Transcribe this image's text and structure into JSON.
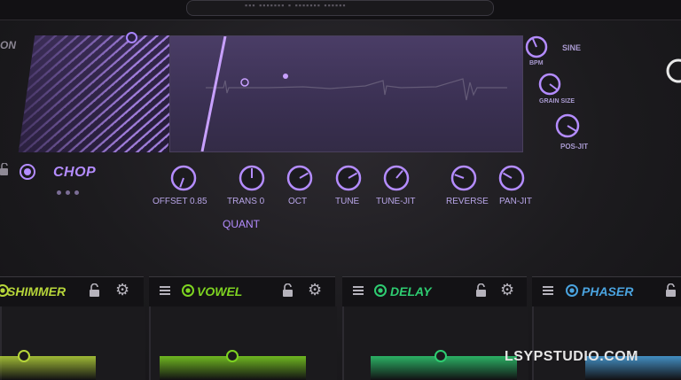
{
  "header": {
    "top_text": "▪▪▪ ▪▪▪▪▪▪▪ ▪ ▪▪▪▪▪▪▪ ▪▪▪▪▪▪"
  },
  "left_panel": {
    "fragment_label": "ON"
  },
  "grain": {
    "accent": "#b48cff"
  },
  "right_knobs": [
    {
      "label": "SINE",
      "icon": "sine-knob"
    },
    {
      "label": "GRAIN SIZE",
      "icon": "grain-size-knob"
    },
    {
      "label": "POS-JIT",
      "icon": "pos-jit-knob"
    }
  ],
  "right_knob_sub": "BPM",
  "chop": {
    "label": "CHOP"
  },
  "knobs": [
    {
      "id": "offset",
      "label": "OFFSET 0.85"
    },
    {
      "id": "trans",
      "label": "TRANS 0"
    },
    {
      "id": "oct",
      "label": "OCT"
    },
    {
      "id": "tune",
      "label": "TUNE"
    },
    {
      "id": "tune-jit",
      "label": "TUNE-JIT"
    },
    {
      "id": "reverse",
      "label": "REVERSE"
    },
    {
      "id": "pan-jit",
      "label": "PAN-JIT"
    }
  ],
  "quant": {
    "label": "QUANT"
  },
  "fx_slots": [
    {
      "label": "SHIMMER",
      "color": "#b7d63a"
    },
    {
      "label": "VOWEL",
      "color": "#7ed321"
    },
    {
      "label": "DELAY",
      "color": "#2ecc71"
    },
    {
      "label": "PHASER",
      "color": "#4aa3df"
    }
  ],
  "watermark": "LSYPSTUDIO.COM"
}
